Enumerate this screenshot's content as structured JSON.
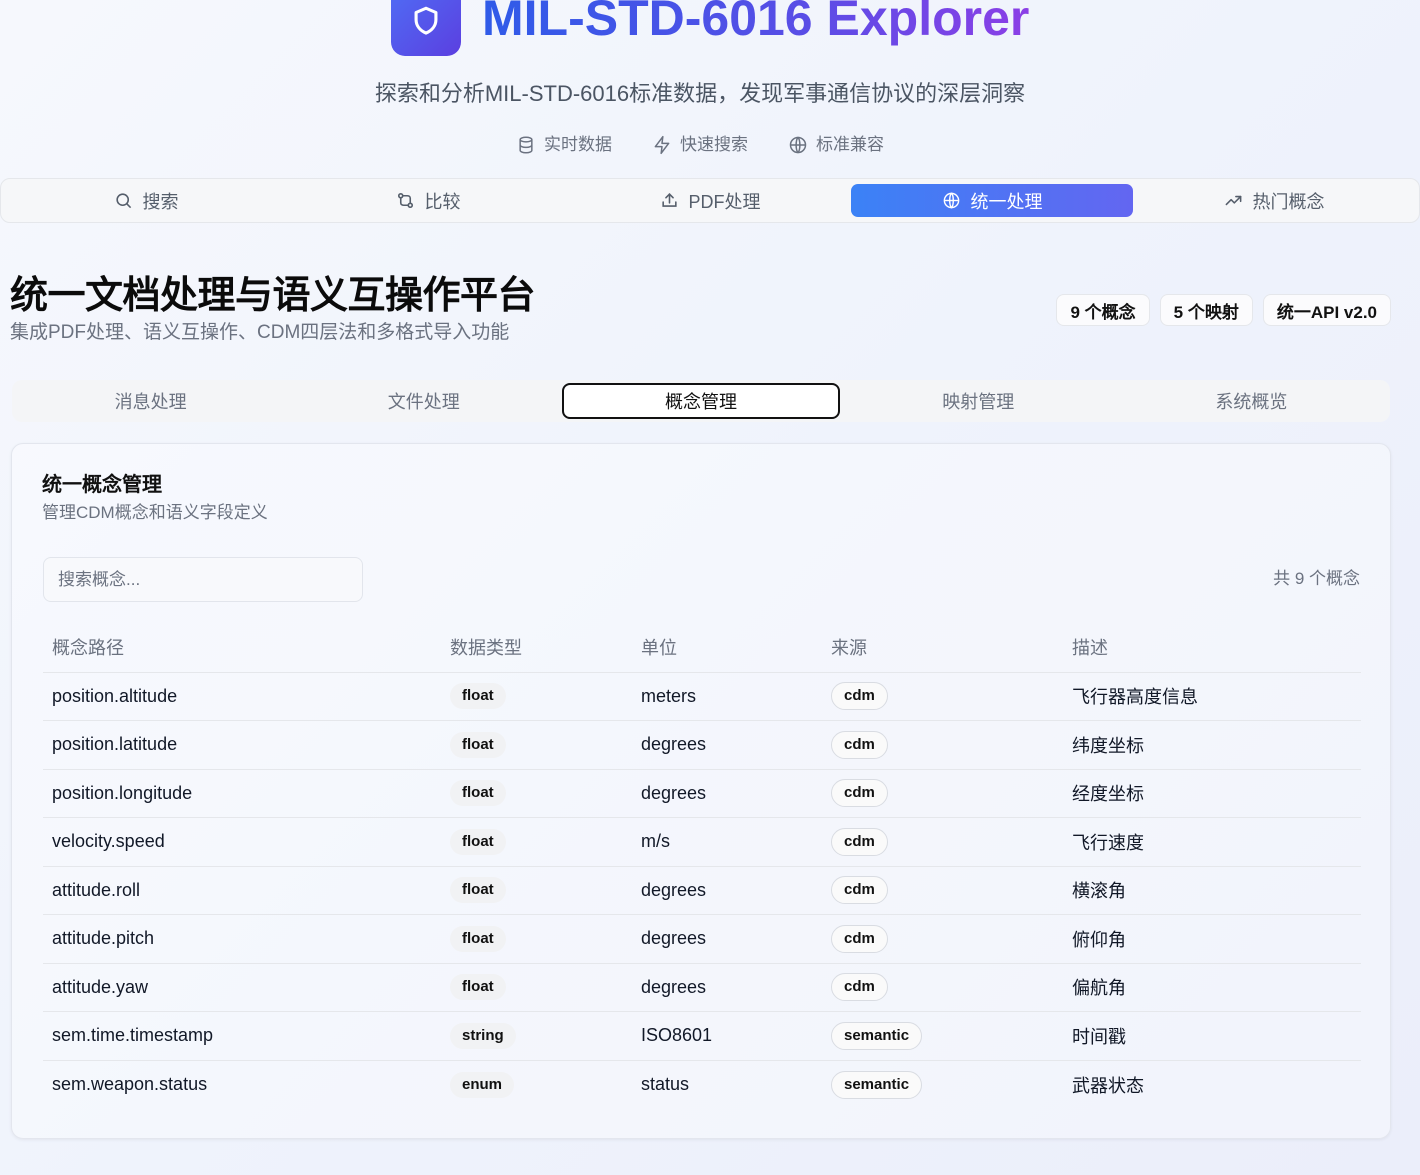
{
  "hero": {
    "title": "MIL-STD-6016 Explorer",
    "subtitle": "探索和分析MIL-STD-6016标准数据，发现军事通信协议的深层洞察",
    "features": [
      {
        "icon": "database-icon",
        "label": "实时数据"
      },
      {
        "icon": "zap-icon",
        "label": "快速搜索"
      },
      {
        "icon": "globe-icon",
        "label": "标准兼容"
      }
    ]
  },
  "main_tabs": [
    {
      "icon": "search-icon",
      "label": "搜索",
      "active": false
    },
    {
      "icon": "compare-icon",
      "label": "比较",
      "active": false
    },
    {
      "icon": "upload-icon",
      "label": "PDF处理",
      "active": false
    },
    {
      "icon": "globe-icon",
      "label": "统一处理",
      "active": true
    },
    {
      "icon": "trending-up-icon",
      "label": "热门概念",
      "active": false
    }
  ],
  "platform": {
    "title": "统一文档处理与语义互操作平台",
    "subtitle": "集成PDF处理、语义互操作、CDM四层法和多格式导入功能",
    "badges": [
      "9 个概念",
      "5 个映射",
      "统一API v2.0"
    ]
  },
  "sub_tabs": [
    {
      "label": "消息处理",
      "active": false
    },
    {
      "label": "文件处理",
      "active": false
    },
    {
      "label": "概念管理",
      "active": true
    },
    {
      "label": "映射管理",
      "active": false
    },
    {
      "label": "系统概览",
      "active": false
    }
  ],
  "concepts": {
    "title": "统一概念管理",
    "subtitle": "管理CDM概念和语义字段定义",
    "search_placeholder": "搜索概念...",
    "count_text": "共 9 个概念",
    "columns": [
      "概念路径",
      "数据类型",
      "单位",
      "来源",
      "描述"
    ],
    "rows": [
      {
        "path": "position.altitude",
        "type": "float",
        "unit": "meters",
        "source": "cdm",
        "desc": "飞行器高度信息"
      },
      {
        "path": "position.latitude",
        "type": "float",
        "unit": "degrees",
        "source": "cdm",
        "desc": "纬度坐标"
      },
      {
        "path": "position.longitude",
        "type": "float",
        "unit": "degrees",
        "source": "cdm",
        "desc": "经度坐标"
      },
      {
        "path": "velocity.speed",
        "type": "float",
        "unit": "m/s",
        "source": "cdm",
        "desc": "飞行速度"
      },
      {
        "path": "attitude.roll",
        "type": "float",
        "unit": "degrees",
        "source": "cdm",
        "desc": "横滚角"
      },
      {
        "path": "attitude.pitch",
        "type": "float",
        "unit": "degrees",
        "source": "cdm",
        "desc": "俯仰角"
      },
      {
        "path": "attitude.yaw",
        "type": "float",
        "unit": "degrees",
        "source": "cdm",
        "desc": "偏航角"
      },
      {
        "path": "sem.time.timestamp",
        "type": "string",
        "unit": "ISO8601",
        "source": "semantic",
        "desc": "时间戳"
      },
      {
        "path": "sem.weapon.status",
        "type": "enum",
        "unit": "status",
        "source": "semantic",
        "desc": "武器状态"
      }
    ]
  }
}
